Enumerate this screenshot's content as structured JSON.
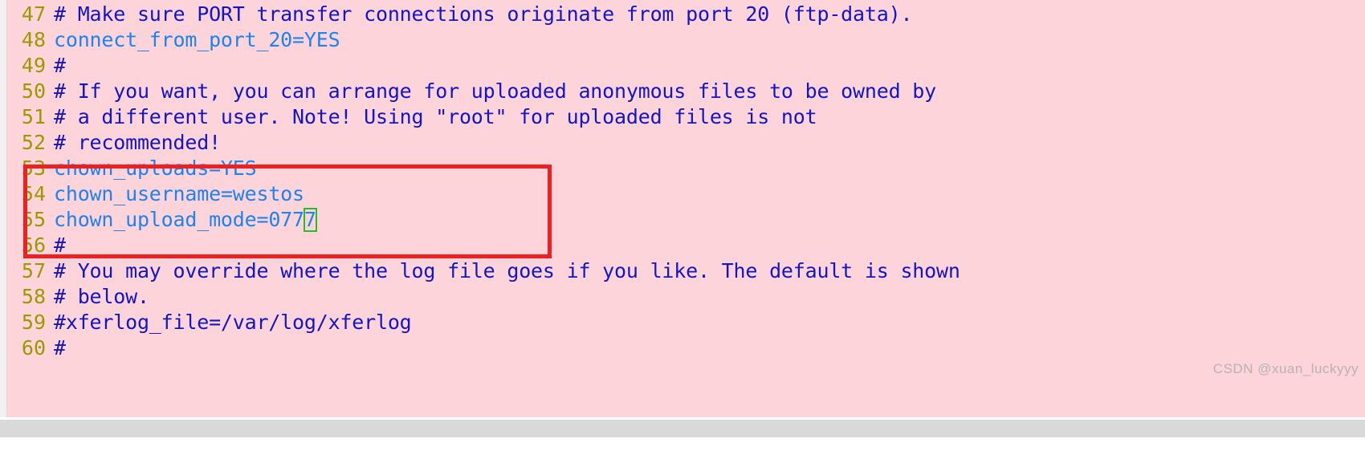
{
  "app": {
    "type": "terminal-text-editor",
    "file_kind": "vsftpd configuration file"
  },
  "colors": {
    "background": "#fcd4da",
    "line_number": "#9a9a00",
    "comment_text": "#1414c8",
    "setting_text": "#1e82f0",
    "annotation_box": "#ee2020",
    "cursor_box": "#22c022",
    "left_rail": "#f2f0f0",
    "bottom_band": "#d9d9d9",
    "watermark": "#b9b2b4"
  },
  "editor": {
    "lines": [
      {
        "number": "47",
        "text": "# Make sure PORT transfer connections originate from port 20 (ftp-data).",
        "kind": "comment"
      },
      {
        "number": "48",
        "text": "connect_from_port_20=YES",
        "kind": "setting"
      },
      {
        "number": "49",
        "text": "#",
        "kind": "comment"
      },
      {
        "number": "50",
        "text": "# If you want, you can arrange for uploaded anonymous files to be owned by",
        "kind": "comment"
      },
      {
        "number": "51",
        "text": "# a different user. Note! Using \"root\" for uploaded files is not",
        "kind": "comment"
      },
      {
        "number": "52",
        "text": "# recommended!",
        "kind": "comment"
      },
      {
        "number": "53",
        "text": "chown_uploads=YES",
        "kind": "setting"
      },
      {
        "number": "54",
        "text": "chown_username=westos",
        "kind": "setting"
      },
      {
        "number": "55",
        "text": "chown_upload_mode=0777",
        "kind": "setting"
      },
      {
        "number": "56",
        "text": "#",
        "kind": "comment"
      },
      {
        "number": "57",
        "text": "# You may override where the log file goes if you like. The default is shown",
        "kind": "comment"
      },
      {
        "number": "58",
        "text": "# below.",
        "kind": "comment"
      },
      {
        "number": "59",
        "text": "#xferlog_file=/var/log/xferlog",
        "kind": "comment"
      },
      {
        "number": "60",
        "text": "#",
        "kind": "comment"
      }
    ]
  },
  "cursor": {
    "on_line": "55",
    "text_before": "chown_upload_mode=077",
    "character": "7",
    "text_after": ""
  },
  "annotation": {
    "label": "red-highlight-rectangle",
    "covers_lines": [
      "53",
      "54",
      "55"
    ]
  },
  "watermark": {
    "text": "CSDN @xuan_luckyyy"
  }
}
